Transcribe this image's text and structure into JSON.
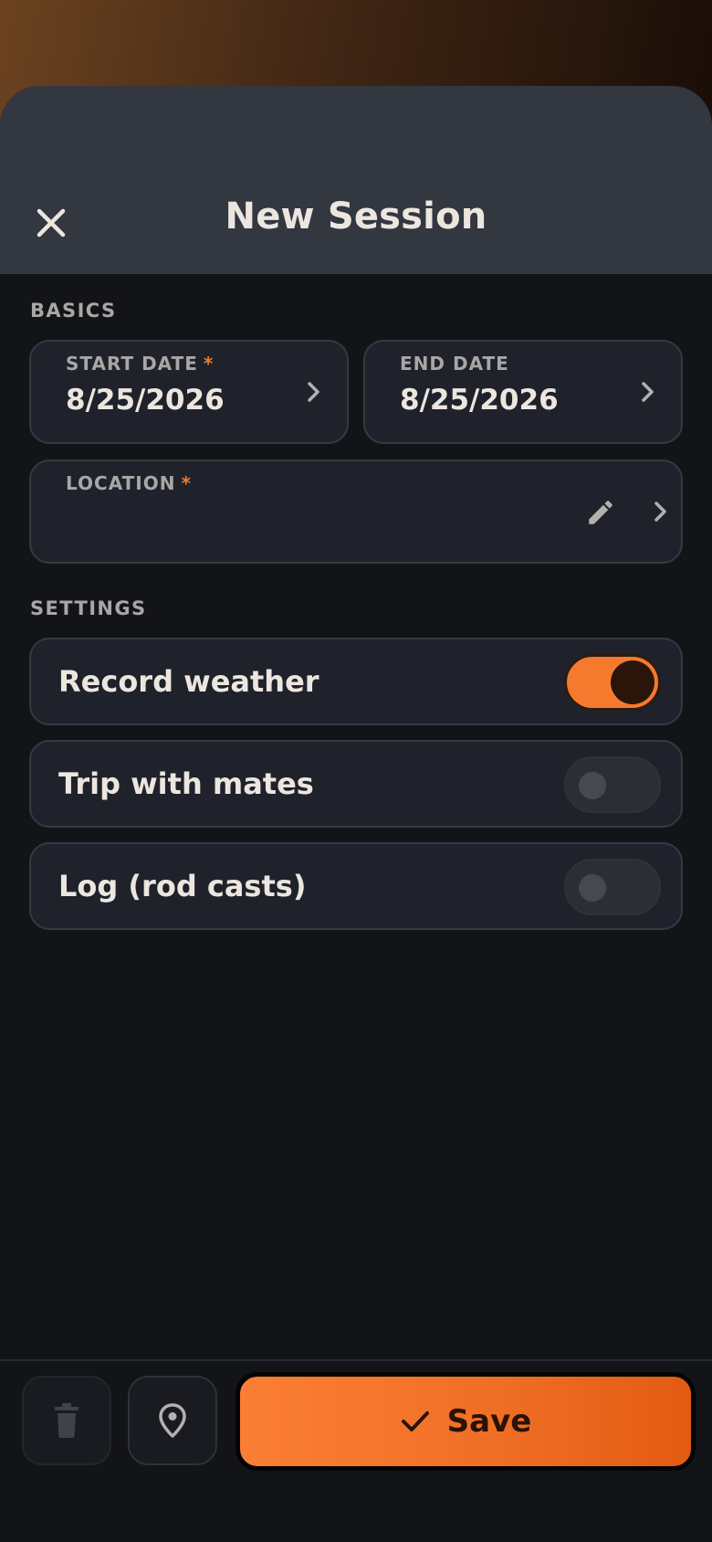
{
  "header": {
    "title": "New Session",
    "close_icon": "close-icon"
  },
  "basics": {
    "section_label": "BASICS",
    "start_date": {
      "label": "START DATE",
      "required_mark": "*",
      "value": "8/25/2026"
    },
    "end_date": {
      "label": "END DATE",
      "value": "8/25/2026"
    },
    "location": {
      "label": "LOCATION",
      "required_mark": "*",
      "value": ""
    }
  },
  "settings": {
    "section_label": "SETTINGS",
    "items": [
      {
        "label": "Record weather",
        "enabled": true
      },
      {
        "label": "Trip with mates",
        "enabled": false
      },
      {
        "label": "Log (rod casts)",
        "enabled": false
      }
    ]
  },
  "bottom_bar": {
    "delete_icon": "trash-icon",
    "location_icon": "map-pin-icon",
    "save_label": "Save",
    "save_icon": "checkmark-icon"
  },
  "colors": {
    "accent": "#f57a2e",
    "required": "#f07a32",
    "header_bg": "#323740",
    "page_bg": "#131418",
    "card_bg": "#1f222a"
  }
}
